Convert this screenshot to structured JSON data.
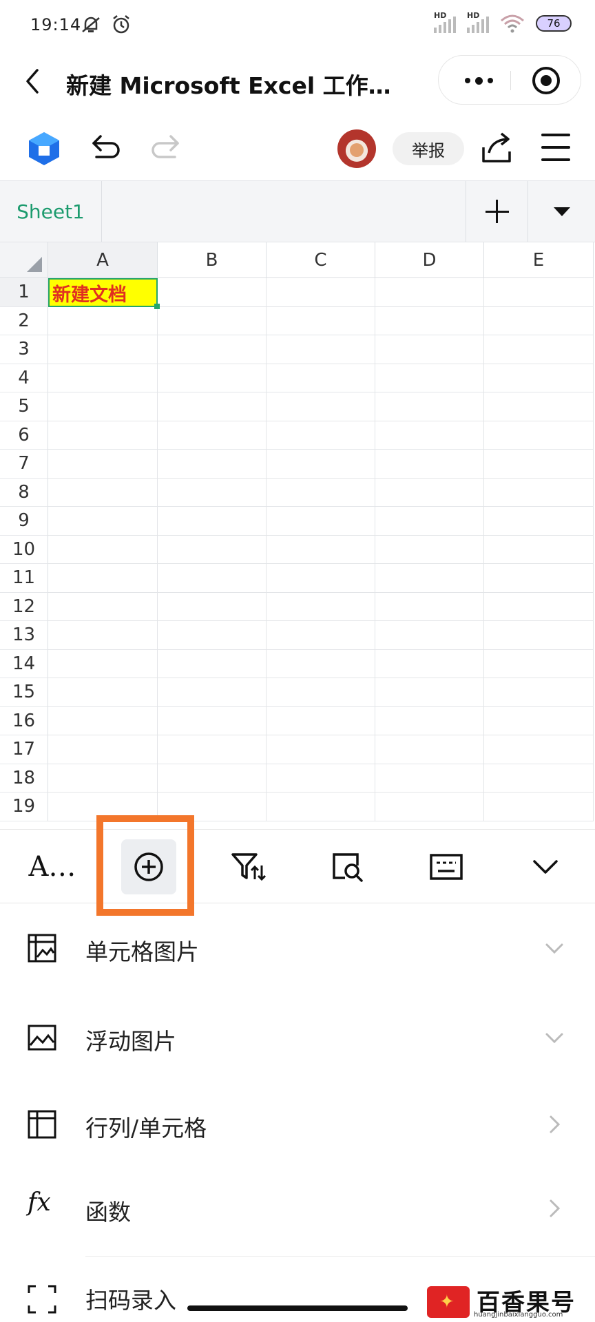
{
  "status_bar": {
    "time": "19:14",
    "signal1_label": "HD",
    "signal2_label": "HD",
    "battery": "76",
    "icons": [
      "mute-icon",
      "alarm-icon",
      "signal-icon",
      "signal-icon",
      "wifi-icon",
      "battery-icon"
    ]
  },
  "title_bar": {
    "title": "新建 Microsoft Excel 工作…",
    "icons": [
      "back-icon",
      "more-icon",
      "close-target-icon"
    ]
  },
  "toolbar": {
    "report_label": "举报",
    "icons": [
      "app-logo-icon",
      "undo-icon",
      "redo-icon",
      "avatar",
      "share-icon",
      "menu-icon"
    ]
  },
  "sheets": {
    "tabs": [
      {
        "label": "Sheet1"
      }
    ],
    "icons": [
      "add-sheet-icon",
      "dropdown-icon"
    ]
  },
  "spreadsheet": {
    "columns": [
      "A",
      "B",
      "C",
      "D",
      "E"
    ],
    "rows": [
      "1",
      "2",
      "3",
      "4",
      "5",
      "6",
      "7",
      "8",
      "9",
      "10",
      "11",
      "12",
      "13",
      "14",
      "15",
      "16",
      "17",
      "18",
      "19"
    ],
    "cells": {
      "A1": "新建文档"
    },
    "selected_cell": "A1",
    "colors": {
      "selected_fill": "#ffff00",
      "selected_text": "#e03020",
      "selection_border": "#25a56b"
    }
  },
  "function_bar": {
    "font_label": "A…",
    "icons": [
      "font-icon",
      "insert-icon",
      "filter-sort-icon",
      "find-icon",
      "keyboard-icon",
      "collapse-icon"
    ],
    "highlight_color": "#f3762b"
  },
  "insert_menu": {
    "items": [
      {
        "label": "单元格图片",
        "icon": "cell-image-icon",
        "arrow": "chevron-down-icon"
      },
      {
        "label": "浮动图片",
        "icon": "float-image-icon",
        "arrow": "chevron-down-icon"
      },
      {
        "label": "行列/单元格",
        "icon": "table-icon",
        "arrow": "chevron-right-icon"
      },
      {
        "label": "函数",
        "icon": "function-icon",
        "arrow": "chevron-right-icon"
      },
      {
        "label": "扫码录入",
        "icon": "scan-icon"
      }
    ],
    "function_glyph": "fx"
  },
  "watermark": {
    "text": "百香果号",
    "url": "huangjinbaixiangguo.com"
  }
}
